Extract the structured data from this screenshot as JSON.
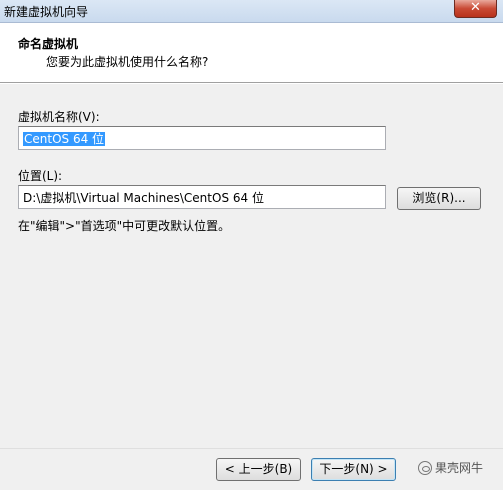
{
  "window": {
    "title": "新建虚拟机向导",
    "close_label": "✕"
  },
  "header": {
    "title": "命名虚拟机",
    "subtitle": "您要为此虚拟机使用什么名称?"
  },
  "form": {
    "name_label": "虚拟机名称(V):",
    "name_value": "CentOS 64 位",
    "location_label": "位置(L):",
    "location_value": "D:\\虚拟机\\Virtual Machines\\CentOS 64 位",
    "browse_label": "浏览(R)...",
    "hint": "在\"编辑\">\"首选项\"中可更改默认位置。"
  },
  "footer": {
    "back_label": "< 上一步(B)",
    "next_label": "下一步(N) >"
  },
  "watermark": {
    "text": "果壳网牛"
  }
}
